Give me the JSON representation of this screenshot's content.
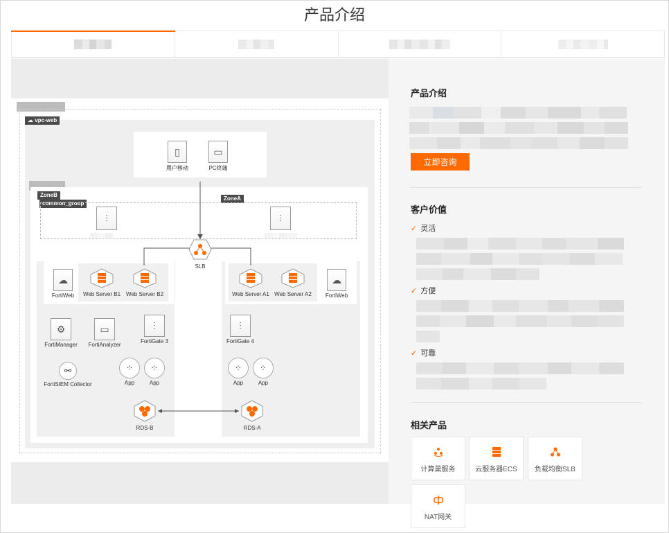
{
  "page": {
    "title": "产品介绍"
  },
  "tabs": [
    {
      "label": "",
      "active": true
    },
    {
      "label": "",
      "active": false
    },
    {
      "label": "",
      "active": false
    },
    {
      "label": "",
      "active": false
    }
  ],
  "diagram": {
    "vpc_tag": "vpc-web",
    "zone_b_tag": "ZoneB",
    "group_tag": "common_group",
    "zone_a_tag": "ZoneA",
    "nodes": {
      "mobile": "用户移动",
      "pc": "PC终端",
      "slb": "SLB",
      "fortiweb_b": "FortiWeb",
      "web_b1": "Web Server B1",
      "web_b2": "Web Server B2",
      "web_a1": "Web Server A1",
      "web_a2": "Web Server A2",
      "fortiweb_a": "FortiWeb",
      "fortimanager": "FortiManager",
      "fortianalyzer": "FortiAnalyzer",
      "fortigate3": "FortiGate 3",
      "fortigate4": "FortiGate 4",
      "fortisiem": "FortiSIEM Collector",
      "app": "App",
      "rds_b": "RDS-B",
      "rds_a": "RDS-A"
    }
  },
  "sidebar": {
    "intro_heading": "产品介绍",
    "consult_button": "立即咨询",
    "value_heading": "客户价值",
    "values": [
      {
        "label": "灵活"
      },
      {
        "label": "方便"
      },
      {
        "label": "可靠"
      }
    ],
    "related_heading": "相关产品",
    "related": [
      {
        "label": "计算巢服务",
        "icon": "compute-nest-icon"
      },
      {
        "label": "云服务器ECS",
        "icon": "ecs-server-icon"
      },
      {
        "label": "负载均衡SLB",
        "icon": "slb-icon"
      },
      {
        "label": "NAT网关",
        "icon": "nat-gateway-icon"
      }
    ]
  },
  "colors": {
    "accent": "#ff6a00",
    "sidebar_bg": "#f5f5f5",
    "diagram_bg": "#ececec"
  }
}
